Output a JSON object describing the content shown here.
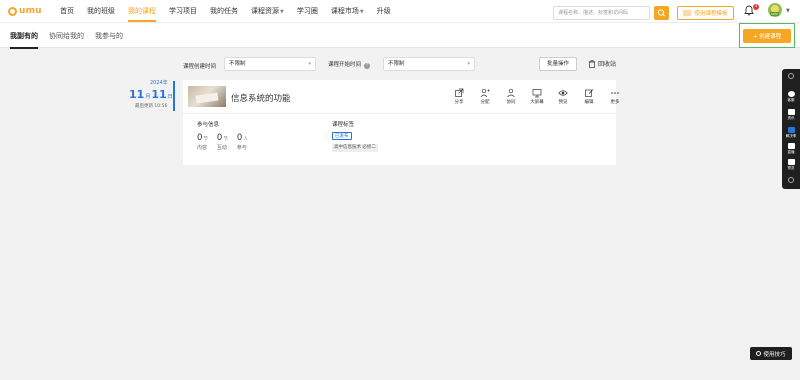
{
  "brand": {
    "name": "umu",
    "color": "#f5a623"
  },
  "nav": {
    "items": [
      {
        "label": "首页",
        "active": false,
        "dropdown": false
      },
      {
        "label": "我的班级",
        "active": false,
        "dropdown": false
      },
      {
        "label": "我的课程",
        "active": true,
        "dropdown": false
      },
      {
        "label": "学习项目",
        "active": false,
        "dropdown": false
      },
      {
        "label": "我的任务",
        "active": false,
        "dropdown": false
      },
      {
        "label": "课程资源",
        "active": false,
        "dropdown": true
      },
      {
        "label": "学习圈",
        "active": false,
        "dropdown": false
      },
      {
        "label": "课程市场",
        "active": false,
        "dropdown": true
      },
      {
        "label": "升级",
        "active": false,
        "dropdown": false
      }
    ],
    "notification_count": "1",
    "avatar_tag": "UMU"
  },
  "tabs": [
    {
      "label": "我副有的",
      "active": true
    },
    {
      "label": "协同给我的",
      "active": false
    },
    {
      "label": "我参与的",
      "active": false
    }
  ],
  "search": {
    "placeholder": "课程名称、描述、标签和访问码"
  },
  "buttons": {
    "template": "使用课程模板",
    "create": "+ 创建课程",
    "batch": "批量操作",
    "recycle": "回收站"
  },
  "filters": {
    "created_label": "课程创建时间",
    "created_value": "不限制",
    "start_label": "课程开始时间",
    "start_value": "不限制"
  },
  "timeline": {
    "year": "2024年",
    "month": "11",
    "month_unit": "月",
    "day": "11",
    "day_unit": "日",
    "updated": "最后更新 10:56"
  },
  "course": {
    "title": "信息系统的功能",
    "actions": [
      {
        "label": "分享",
        "icon": "share-icon"
      },
      {
        "label": "分配",
        "icon": "assign-icon"
      },
      {
        "label": "协同",
        "icon": "collaborate-icon"
      },
      {
        "label": "大屏幕",
        "icon": "big-screen-icon"
      },
      {
        "label": "预览",
        "icon": "preview-icon"
      },
      {
        "label": "编辑",
        "icon": "edit-icon"
      },
      {
        "label": "更多",
        "icon": "more-icon"
      }
    ],
    "participation": {
      "title": "参与信息",
      "stats": [
        {
          "num": "0",
          "unit": "节",
          "label": "内容"
        },
        {
          "num": "0",
          "unit": "节",
          "label": "互动"
        },
        {
          "num": "0",
          "unit": "人",
          "label": "参与"
        }
      ]
    },
    "tags_title": "课程标签",
    "status_badge": "已发布",
    "tag": "高中信息技术 必修二"
  },
  "right_toolbar": [
    {
      "label": "",
      "icon": "shield-icon"
    },
    {
      "label": "客服",
      "icon": "headset-icon"
    },
    {
      "label": "资讯",
      "icon": "news-icon"
    },
    {
      "label": "解决率",
      "icon": "chart-icon"
    },
    {
      "label": "直播",
      "icon": "live-icon"
    },
    {
      "label": "预览",
      "icon": "doc-icon"
    },
    {
      "label": "",
      "icon": "settings-icon"
    }
  ],
  "tips": "使用技巧"
}
